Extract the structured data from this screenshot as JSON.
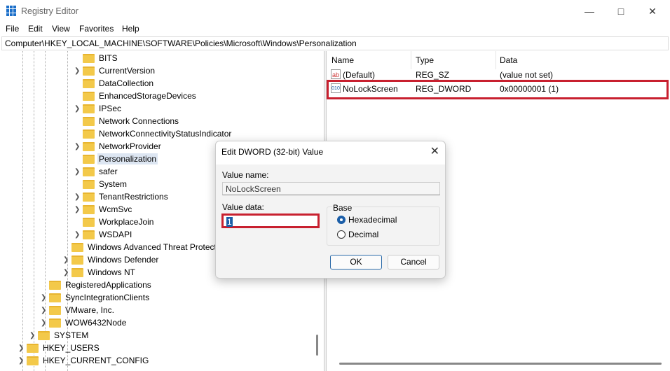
{
  "window": {
    "title": "Registry Editor",
    "accent": "#1b6fc9"
  },
  "menu": [
    "File",
    "Edit",
    "View",
    "Favorites",
    "Help"
  ],
  "address": "Computer\\HKEY_LOCAL_MACHINE\\SOFTWARE\\Policies\\Microsoft\\Windows\\Personalization",
  "tree": [
    {
      "label": "BITS",
      "level": 5,
      "expand": false
    },
    {
      "label": "CurrentVersion",
      "level": 5,
      "expand": true
    },
    {
      "label": "DataCollection",
      "level": 5,
      "expand": false
    },
    {
      "label": "EnhancedStorageDevices",
      "level": 5,
      "expand": false
    },
    {
      "label": "IPSec",
      "level": 5,
      "expand": true
    },
    {
      "label": "Network Connections",
      "level": 5,
      "expand": false
    },
    {
      "label": "NetworkConnectivityStatusIndicator",
      "level": 5,
      "expand": false
    },
    {
      "label": "NetworkProvider",
      "level": 5,
      "expand": true
    },
    {
      "label": "Personalization",
      "level": 5,
      "expand": false,
      "selected": true
    },
    {
      "label": "safer",
      "level": 5,
      "expand": true
    },
    {
      "label": "System",
      "level": 5,
      "expand": false
    },
    {
      "label": "TenantRestrictions",
      "level": 5,
      "expand": true
    },
    {
      "label": "WcmSvc",
      "level": 5,
      "expand": true
    },
    {
      "label": "WorkplaceJoin",
      "level": 5,
      "expand": false
    },
    {
      "label": "WSDAPI",
      "level": 5,
      "expand": true
    },
    {
      "label": "Windows Advanced Threat Protection",
      "level": 4,
      "expand": false
    },
    {
      "label": "Windows Defender",
      "level": 4,
      "expand": true
    },
    {
      "label": "Windows NT",
      "level": 4,
      "expand": true
    },
    {
      "label": "RegisteredApplications",
      "level": 2,
      "expand": false
    },
    {
      "label": "SyncIntegrationClients",
      "level": 2,
      "expand": true
    },
    {
      "label": "VMware, Inc.",
      "level": 2,
      "expand": true
    },
    {
      "label": "WOW6432Node",
      "level": 2,
      "expand": true
    },
    {
      "label": "SYSTEM",
      "level": 1,
      "expand": true
    },
    {
      "label": "HKEY_USERS",
      "level": 0,
      "expand": true
    },
    {
      "label": "HKEY_CURRENT_CONFIG",
      "level": 0,
      "expand": true
    }
  ],
  "values": {
    "headers": {
      "name": "Name",
      "type": "Type",
      "data": "Data"
    },
    "rows": [
      {
        "icon": "ab",
        "name": "(Default)",
        "type": "REG_SZ",
        "data": "(value not set)"
      },
      {
        "icon": "010",
        "name": "NoLockScreen",
        "type": "REG_DWORD",
        "data": "0x00000001 (1)"
      }
    ]
  },
  "dialog": {
    "title": "Edit DWORD (32-bit) Value",
    "value_name_label": "Value name:",
    "value_name": "NoLockScreen",
    "value_data_label": "Value data:",
    "value_data": "1",
    "base_label": "Base",
    "hex_label": "Hexadecimal",
    "dec_label": "Decimal",
    "selected_base": "Hexadecimal",
    "ok": "OK",
    "cancel": "Cancel"
  },
  "highlight_color": "#c8202f"
}
